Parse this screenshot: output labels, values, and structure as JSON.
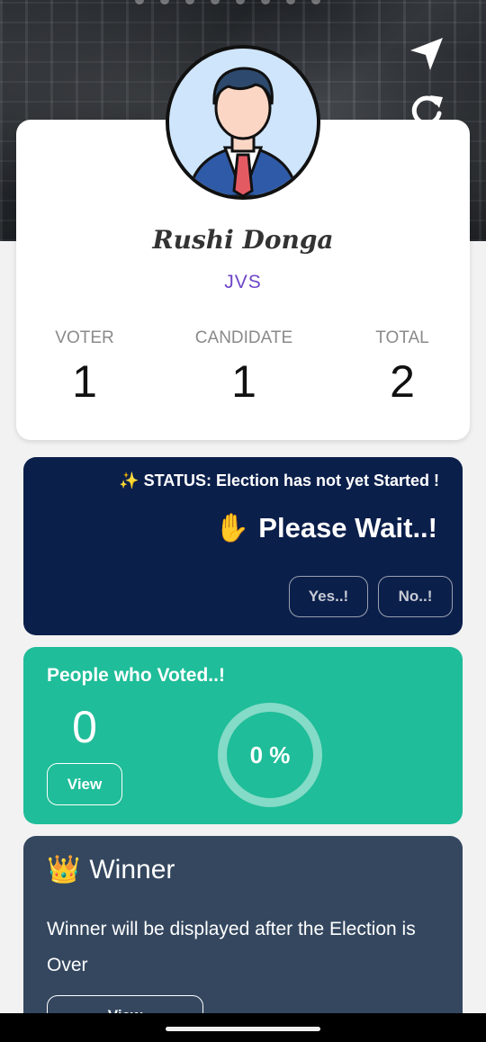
{
  "header": {
    "icons": [
      "navigation-arrow-icon",
      "refresh-icon"
    ]
  },
  "profile": {
    "name": "Rushi Donga",
    "organization": "JVS",
    "stats": [
      {
        "label": "VOTER",
        "value": "1"
      },
      {
        "label": "CANDIDATE",
        "value": "1"
      },
      {
        "label": "TOTAL",
        "value": "2"
      }
    ]
  },
  "status": {
    "message": "✨ STATUS: Election has not yet Started !",
    "headline_icon": "✋",
    "headline": "Please Wait..!",
    "yes_label": "Yes..!",
    "no_label": "No..!"
  },
  "votes": {
    "title": "People who Voted..!",
    "count": "0",
    "view_label": "View",
    "percent_label": "0 %",
    "percent": 0
  },
  "winner": {
    "icon": "👑",
    "title": "Winner",
    "description": "Winner will be displayed after the Election is Over",
    "view_label": "View"
  },
  "colors": {
    "status_card": "#0b1f4b",
    "votes_card": "#1fbd99",
    "winner_card": "#34475f",
    "accent_text": "#6e45c8"
  }
}
